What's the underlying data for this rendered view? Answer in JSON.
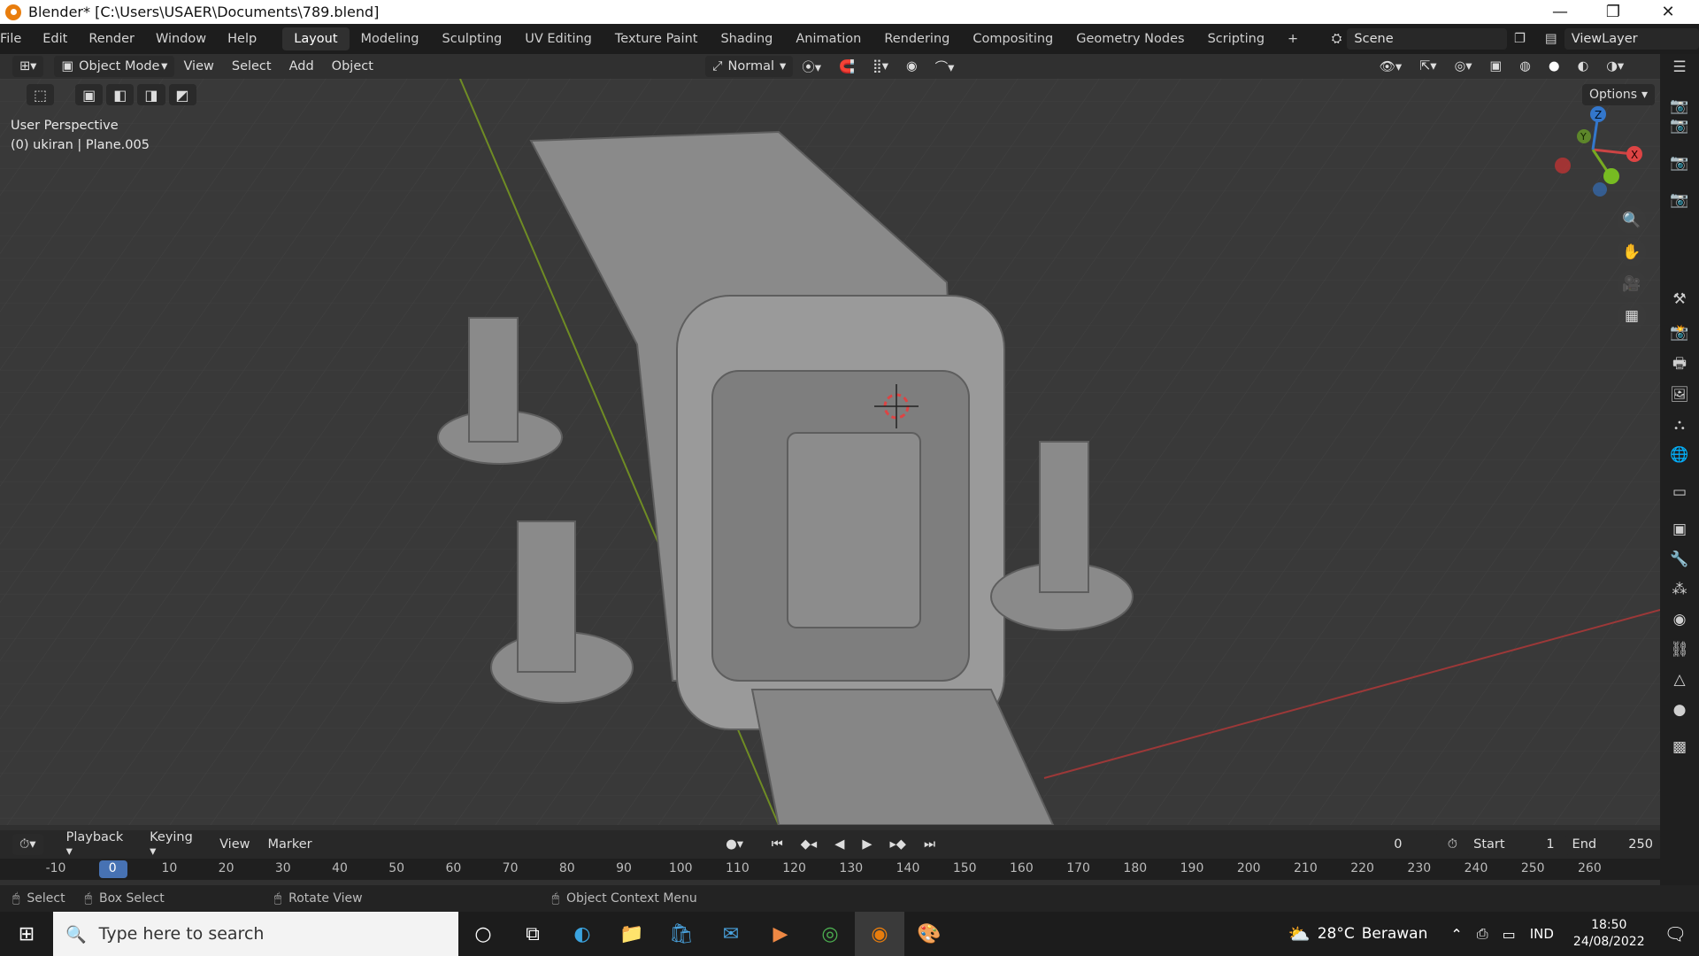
{
  "window": {
    "title": "Blender* [C:\\Users\\USAER\\Documents\\789.blend]",
    "minimize": "—",
    "maximize": "❐",
    "close": "✕"
  },
  "menubar": {
    "items": [
      "File",
      "Edit",
      "Render",
      "Window",
      "Help"
    ],
    "workspaces": [
      "Layout",
      "Modeling",
      "Sculpting",
      "UV Editing",
      "Texture Paint",
      "Shading",
      "Animation",
      "Rendering",
      "Compositing",
      "Geometry Nodes",
      "Scripting"
    ],
    "active_workspace": "Layout",
    "add_tab": "+",
    "scene": "Scene",
    "view_layer": "ViewLayer"
  },
  "header": {
    "mode": "Object Mode",
    "menus": [
      "View",
      "Select",
      "Add",
      "Object"
    ],
    "transform_orientation": "Normal",
    "options": "Options"
  },
  "viewport": {
    "perspective": "User Perspective",
    "object_info": "(0) ukiran | Plane.005",
    "gizmo_axes": [
      "X",
      "Y",
      "Z"
    ]
  },
  "timeline": {
    "menus": [
      "Playback",
      "Keying",
      "View",
      "Marker"
    ],
    "current_frame": "0",
    "start_label": "Start",
    "start": "1",
    "end_label": "End",
    "end": "250",
    "ruler": [
      "-10",
      "0",
      "10",
      "20",
      "30",
      "40",
      "50",
      "60",
      "70",
      "80",
      "90",
      "100",
      "110",
      "120",
      "130",
      "140",
      "150",
      "160",
      "170",
      "180",
      "190",
      "200",
      "210",
      "220",
      "230",
      "240",
      "250",
      "260"
    ]
  },
  "statusbar": {
    "items": [
      "Select",
      "Box Select",
      "Rotate View",
      "Object Context Menu"
    ]
  },
  "taskbar": {
    "search_placeholder": "Type here to search",
    "temperature": "28°C",
    "weather": "Berawan",
    "language": "IND",
    "time": "18:50",
    "date": "24/08/2022"
  },
  "colors": {
    "active_frame": "#4772b3",
    "x_axis": "#b5433d",
    "y_axis": "#7ba12b",
    "z_axis": "#3b78c9"
  }
}
